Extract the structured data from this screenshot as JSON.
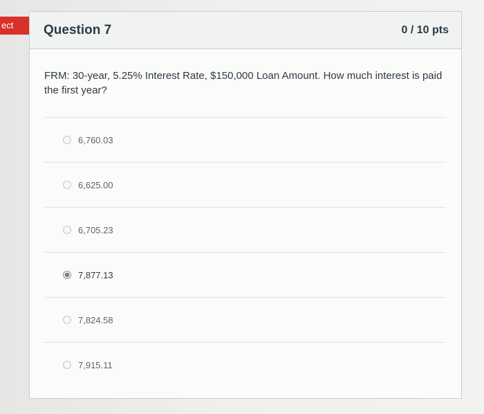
{
  "side_tab": {
    "label": "ect",
    "color": "#d9302a"
  },
  "question": {
    "title": "Question 7",
    "points": "0 / 10 pts",
    "text": "FRM: 30-year, 5.25% Interest Rate, $150,000 Loan Amount. How much interest is paid the first year?"
  },
  "answers": [
    {
      "label": "6,760.03",
      "selected": false
    },
    {
      "label": "6,625.00",
      "selected": false
    },
    {
      "label": "6,705.23",
      "selected": false
    },
    {
      "label": "7,877.13",
      "selected": true
    },
    {
      "label": "7,824.58",
      "selected": false
    },
    {
      "label": "7,915.11",
      "selected": false
    }
  ]
}
